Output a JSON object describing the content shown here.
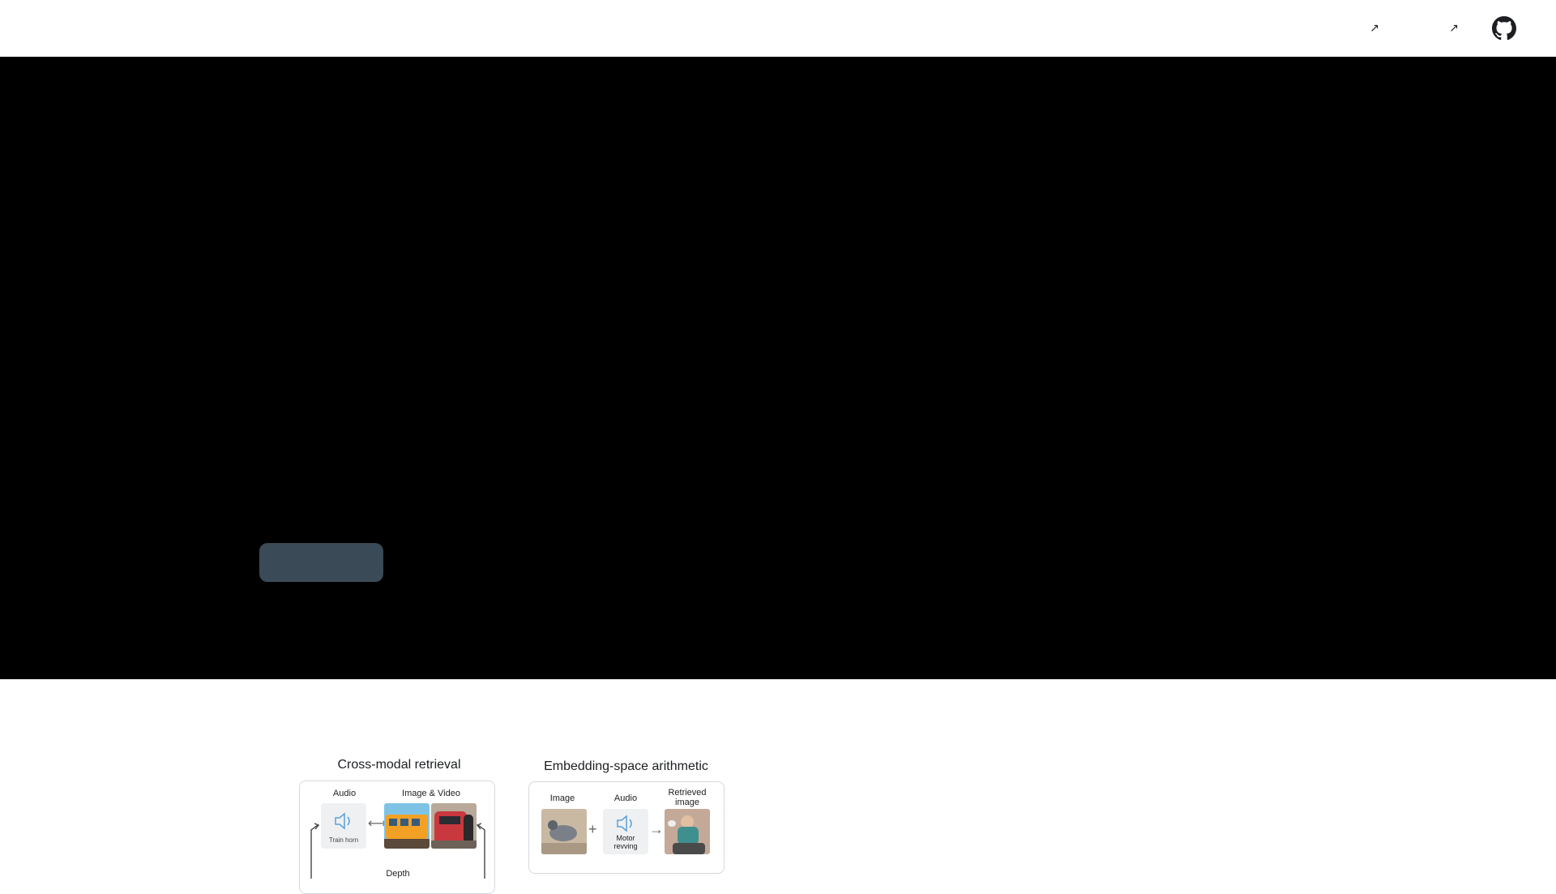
{
  "nav": {
    "link1_icon": "external-arrow-icon",
    "link2_icon": "external-arrow-icon",
    "link1_glyph": "↗",
    "link2_glyph": "↗",
    "github_icon": "github-icon"
  },
  "hero": {
    "background": "#000000",
    "button_color": "#3a4a56"
  },
  "cross_modal": {
    "title": "Cross-modal retrieval",
    "audio_label": "Audio",
    "image_video_label": "Image & Video",
    "audio_caption": "Train horn",
    "depth_label": "Depth",
    "speaker_icon": "speaker-icon",
    "arrow": "⟷"
  },
  "arithmetic": {
    "title": "Embedding-space arithmetic",
    "image_label": "Image",
    "audio_label": "Audio",
    "retrieved_label_line1": "Retrieved",
    "retrieved_label_line2": "image",
    "audio_caption_line1": "Motor",
    "audio_caption_line2": "revving",
    "plus": "+",
    "arrow": "→",
    "speaker_icon": "speaker-icon"
  }
}
